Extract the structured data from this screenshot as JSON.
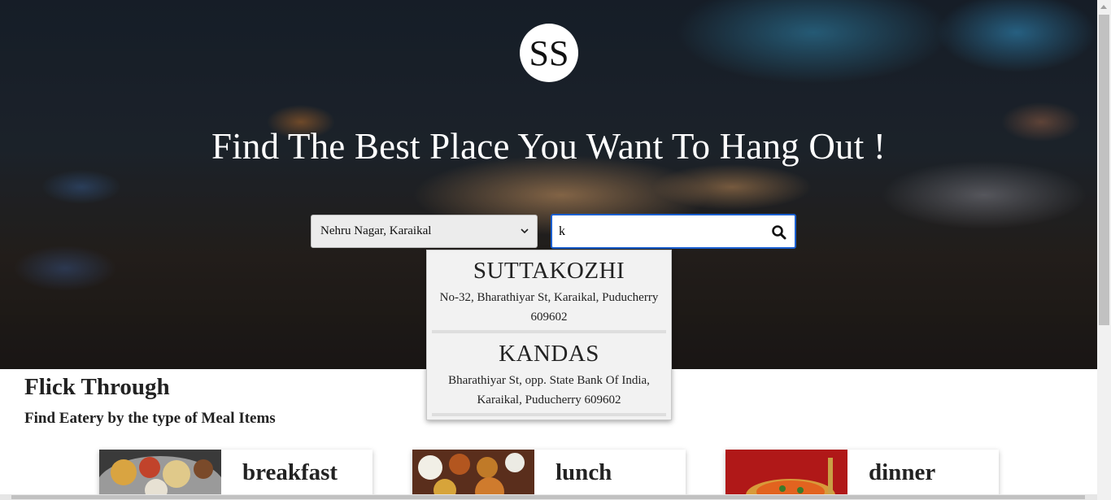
{
  "brand": {
    "logo_text": "SS"
  },
  "hero": {
    "headline": "Find The Best Place You Want To Hang Out !"
  },
  "location_select": {
    "selected": "Nehru Nagar, Karaikal"
  },
  "search": {
    "value": "k",
    "placeholder": ""
  },
  "suggestions": [
    {
      "name": "SUTTAKOZHI",
      "address": "No-32, Bharathiyar St, Karaikal, Puducherry 609602"
    },
    {
      "name": "KANDAS",
      "address": "Bharathiyar St, opp. State Bank Of India, Karaikal, Puducherry 609602"
    }
  ],
  "section": {
    "title": "Flick Through",
    "subtitle": "Find Eatery by the type of Meal Items"
  },
  "meal_cards": [
    {
      "label": "breakfast"
    },
    {
      "label": "lunch"
    },
    {
      "label": "dinner"
    }
  ],
  "colors": {
    "search_focus_border": "#1a5fd0",
    "dropdown_bg": "#f2f2f2"
  }
}
